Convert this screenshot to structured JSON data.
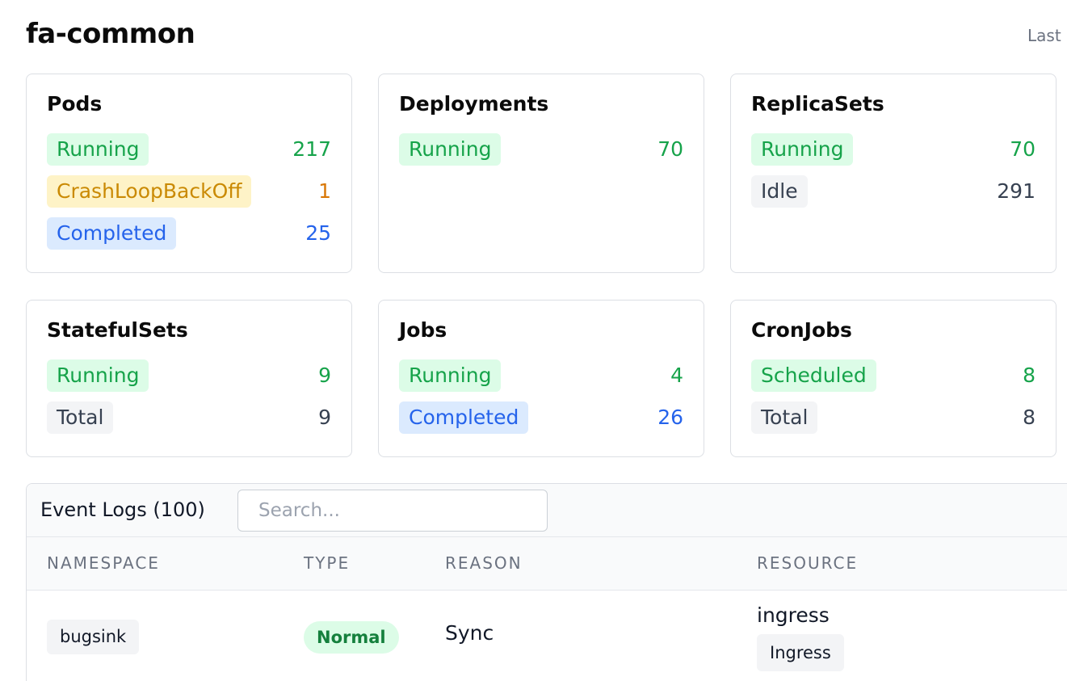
{
  "header": {
    "title": "fa-common",
    "last_label": "Last"
  },
  "cards": [
    {
      "title": "Pods",
      "rows": [
        {
          "label": "Running",
          "count": "217",
          "tone": "green"
        },
        {
          "label": "CrashLoopBackOff",
          "count": "1",
          "tone": "yellow"
        },
        {
          "label": "Completed",
          "count": "25",
          "tone": "blue"
        }
      ]
    },
    {
      "title": "Deployments",
      "rows": [
        {
          "label": "Running",
          "count": "70",
          "tone": "green"
        }
      ]
    },
    {
      "title": "ReplicaSets",
      "rows": [
        {
          "label": "Running",
          "count": "70",
          "tone": "green"
        },
        {
          "label": "Idle",
          "count": "291",
          "tone": "gray"
        }
      ]
    },
    {
      "title": "StatefulSets",
      "rows": [
        {
          "label": "Running",
          "count": "9",
          "tone": "green"
        },
        {
          "label": "Total",
          "count": "9",
          "tone": "gray"
        }
      ]
    },
    {
      "title": "Jobs",
      "rows": [
        {
          "label": "Running",
          "count": "4",
          "tone": "green"
        },
        {
          "label": "Completed",
          "count": "26",
          "tone": "blue"
        }
      ]
    },
    {
      "title": "CronJobs",
      "rows": [
        {
          "label": "Scheduled",
          "count": "8",
          "tone": "green"
        },
        {
          "label": "Total",
          "count": "8",
          "tone": "gray"
        }
      ]
    }
  ],
  "events": {
    "title": "Event Logs (100)",
    "search": {
      "placeholder": "Search...",
      "value": ""
    },
    "columns": [
      "NAMESPACE",
      "TYPE",
      "REASON",
      "RESOURCE"
    ],
    "rows": [
      {
        "namespace": "bugsink",
        "type": "Normal",
        "reason": "Sync",
        "resource_name": "ingress",
        "resource_kind": "Ingress"
      }
    ]
  },
  "colors": {
    "green_bg": "#dcfce7",
    "green_text": "#16a34a",
    "yellow_bg": "#fef3c7",
    "yellow_text": "#ca8a04",
    "blue_bg": "#dbeafe",
    "blue_text": "#2563eb",
    "gray_bg": "#f3f4f6",
    "gray_text": "#374151"
  }
}
